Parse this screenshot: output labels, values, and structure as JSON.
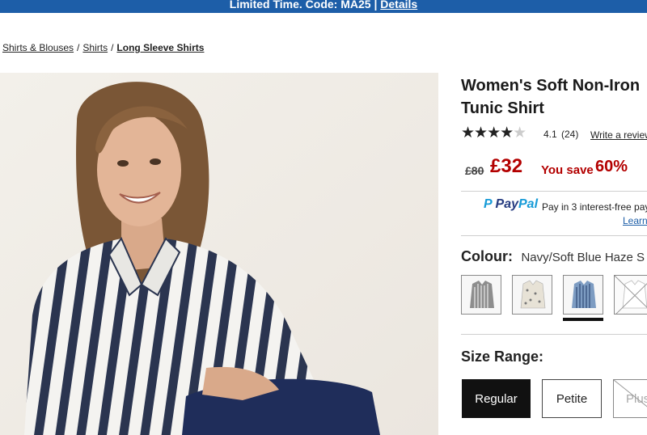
{
  "promo": {
    "text": "Limited Time. Code: MA25 |",
    "link": "Details"
  },
  "breadcrumb": {
    "items": [
      "Shirts & Blouses",
      "Shirts"
    ],
    "separator": "/",
    "current": "Long Sleeve Shirts"
  },
  "product": {
    "title_line1": "Women's Soft Non-Iron",
    "title_line2": "Tunic Shirt",
    "rating": {
      "value": "4.1",
      "count": "(24)",
      "stars": 4.1,
      "review_link": "Write a review"
    },
    "price": {
      "old": "£80",
      "new": "£32",
      "save_label": "You save",
      "save_pct": "60%"
    },
    "paypal": {
      "logo_pay": "Pay",
      "logo_pal": "Pal",
      "text": "Pay in 3 interest-free pay",
      "learn": "Learn"
    },
    "colour": {
      "label": "Colour:",
      "value": "Navy/Soft Blue Haze S",
      "swatches": [
        {
          "name": "grey-stripe",
          "selected": false,
          "available": true
        },
        {
          "name": "cream-print",
          "selected": false,
          "available": true
        },
        {
          "name": "navy-soft-blue-haze",
          "selected": true,
          "available": true
        },
        {
          "name": "white",
          "selected": false,
          "available": false
        }
      ]
    },
    "size_range": {
      "label": "Size Range:",
      "options": [
        "Regular",
        "Petite",
        "Plus"
      ],
      "selected": "Regular",
      "unavailable": [
        "Plus"
      ]
    }
  },
  "colors": {
    "promo_bg": "#1d5ea8",
    "sale_red": "#b30000",
    "stripe_navy": "#2b3550"
  }
}
